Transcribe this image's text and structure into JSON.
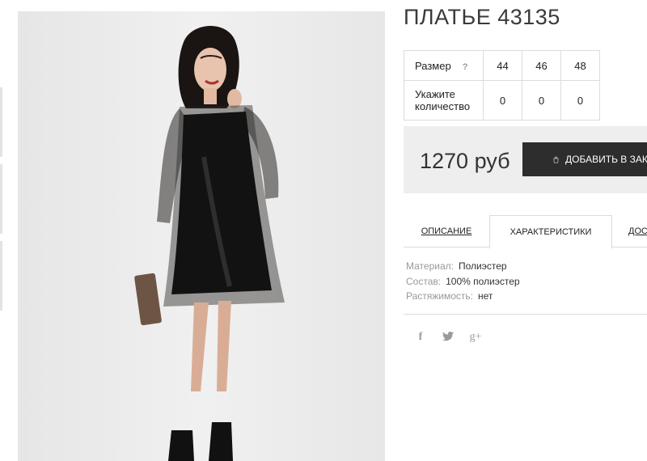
{
  "product": {
    "title": "ПЛАТЬЕ 43135",
    "image_alt": "model wearing black tulle dress over faux leather slip"
  },
  "sizes": {
    "size_label": "Размер",
    "help_label": "?",
    "qty_label": "Укажите количество",
    "items": [
      {
        "size": "44",
        "qty": "0"
      },
      {
        "size": "46",
        "qty": "0"
      },
      {
        "size": "48",
        "qty": "0"
      }
    ]
  },
  "purchase": {
    "price": "1270 руб",
    "add_to_cart": "ДОБАВИТЬ В ЗАКАЗ",
    "cart_icon": "shopping-bag-icon"
  },
  "tabs": [
    {
      "label": "ОПИСАНИЕ",
      "active": false
    },
    {
      "label": "ХАРАКТЕРИСТИКИ",
      "active": true
    },
    {
      "label": "ДОСТАВКА",
      "active": false
    }
  ],
  "specs": [
    {
      "key": "Материал:",
      "value": "Полиэстер"
    },
    {
      "key": "Состав:",
      "value": "100% полиэстер"
    },
    {
      "key": "Растяжимость:",
      "value": "нет"
    }
  ],
  "social": [
    {
      "icon": "facebook-icon",
      "glyph": "f"
    },
    {
      "icon": "twitter-icon",
      "glyph": "t"
    },
    {
      "icon": "google-plus-icon",
      "glyph": "g+"
    }
  ],
  "colors": {
    "button_bg": "#2d2d2d",
    "price_bg": "#eeeeee",
    "border": "#dcdcdc",
    "muted": "#999999"
  }
}
